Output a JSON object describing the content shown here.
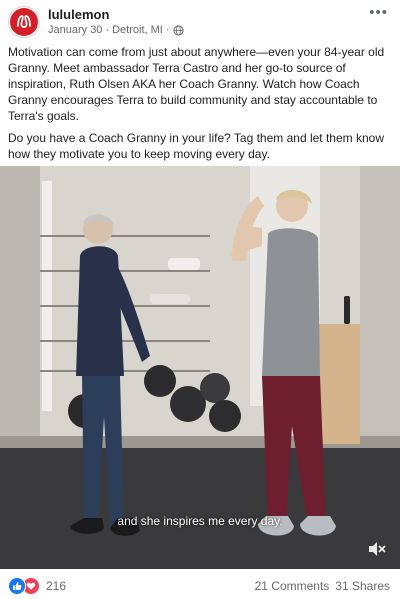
{
  "post": {
    "page_name": "lululemon",
    "date": "January 30",
    "location": "Detroit, MI",
    "separator": "·",
    "audience_icon": "globe-icon",
    "more_icon": "ellipsis-icon",
    "more_label": "•••",
    "text_paragraph_1": "Motivation can come from just about anywhere—even your 84-year old Granny. Meet ambassador Terra Castro and her go-to source of inspiration, Ruth Olsen AKA her Coach Granny. Watch how Coach Granny encourages Terra to build community and stay accountable to Terra's goals.",
    "text_paragraph_2": "Do you have a Coach Granny in your life? Tag them and let them know how they motivate you to keep moving every day."
  },
  "video": {
    "caption": "and she inspires me every day.",
    "mute_icon": "speaker-muted-icon"
  },
  "footer": {
    "reactions_count": "216",
    "comments": "21 Comments",
    "shares": "31 Shares"
  },
  "colors": {
    "brand": "#d31f26",
    "like_blue": "#1877f2",
    "love_red": "#f33e58",
    "meta_gray": "#65676b"
  }
}
